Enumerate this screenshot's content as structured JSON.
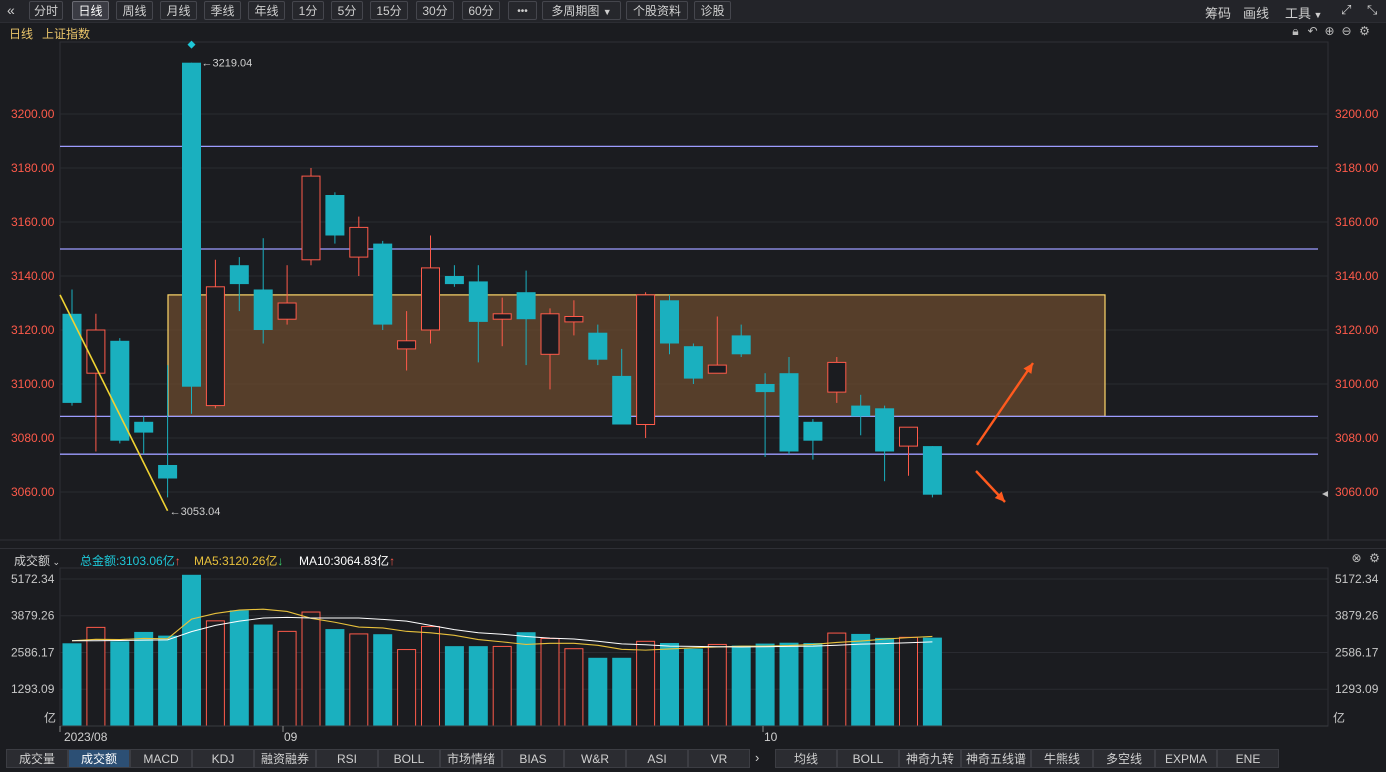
{
  "toolbar": {
    "back_icon": "double-chevron-left-icon",
    "periods": [
      "分时",
      "日线",
      "周线",
      "月线",
      "季线",
      "年线",
      "1分",
      "5分",
      "15分",
      "30分",
      "60分"
    ],
    "active_period": "日线",
    "more": "•••",
    "buttons": [
      "多周期图",
      "个股资料",
      "诊股"
    ],
    "right": {
      "chip": "筹码",
      "draw": "画线",
      "tools": "工具"
    }
  },
  "header": {
    "period": "日线",
    "index_name": "上证指数"
  },
  "price_axis": {
    "ticks": [
      "3200.00",
      "3180.00",
      "3160.00",
      "3140.00",
      "3120.00",
      "3100.00",
      "3080.00",
      "3060.00"
    ]
  },
  "annotations": {
    "high_label": "3219.04",
    "low_label": "3053.04"
  },
  "volume_header": {
    "dropdown": "成交额",
    "total_label": "总金额:3103.06亿",
    "ma5_label": "MA5:3120.26亿",
    "ma10_label": "MA10:3064.83亿"
  },
  "volume_axis": {
    "ticks": [
      "5172.34",
      "3879.26",
      "2586.17",
      "1293.09"
    ],
    "unit": "亿"
  },
  "date_labels": [
    "2023/08",
    "09",
    "10"
  ],
  "bottom_tabs": {
    "left": [
      "成交量",
      "成交额",
      "MACD",
      "KDJ",
      "融资融券",
      "RSI",
      "BOLL",
      "市场情绪",
      "BIAS",
      "W&R",
      "ASI",
      "VR"
    ],
    "active": "成交额",
    "right": [
      "均线",
      "BOLL",
      "神奇九转",
      "神奇五线谱",
      "牛熊线",
      "多空线",
      "EXPMA",
      "ENE"
    ]
  },
  "colors": {
    "up": "#ff5a4a",
    "down": "#1ab0bf",
    "ma5": "#e8c13c",
    "ma10": "#ffffff",
    "box_fill": "#6b4a2e",
    "box_border": "#ffd86a",
    "hline": "#9d9cff",
    "trend": "#f0d232",
    "arrow": "#ff5a1e"
  },
  "chart_data": {
    "type": "candlestick",
    "y_range": [
      3040,
      3230
    ],
    "candles": [
      {
        "o": 3126,
        "h": 3135,
        "l": 3092,
        "c": 3093
      },
      {
        "o": 3104,
        "h": 3126,
        "l": 3075,
        "c": 3120
      },
      {
        "o": 3116,
        "h": 3117,
        "l": 3078,
        "c": 3079
      },
      {
        "o": 3086,
        "h": 3088,
        "l": 3074,
        "c": 3082
      },
      {
        "o": 3070,
        "h": 3107,
        "l": 3058,
        "c": 3065
      },
      {
        "o": 3219,
        "h": 3219,
        "l": 3089,
        "c": 3099
      },
      {
        "o": 3092,
        "h": 3146,
        "l": 3091,
        "c": 3136
      },
      {
        "o": 3144,
        "h": 3147,
        "l": 3127,
        "c": 3137
      },
      {
        "o": 3135,
        "h": 3154,
        "l": 3115,
        "c": 3120
      },
      {
        "o": 3124,
        "h": 3144,
        "l": 3122,
        "c": 3130
      },
      {
        "o": 3146,
        "h": 3180,
        "l": 3144,
        "c": 3177
      },
      {
        "o": 3170,
        "h": 3171,
        "l": 3152,
        "c": 3155
      },
      {
        "o": 3147,
        "h": 3162,
        "l": 3140,
        "c": 3158
      },
      {
        "o": 3152,
        "h": 3153,
        "l": 3120,
        "c": 3122
      },
      {
        "o": 3113,
        "h": 3127,
        "l": 3105,
        "c": 3116
      },
      {
        "o": 3120,
        "h": 3155,
        "l": 3115,
        "c": 3143
      },
      {
        "o": 3140,
        "h": 3144,
        "l": 3136,
        "c": 3137
      },
      {
        "o": 3138,
        "h": 3144,
        "l": 3108,
        "c": 3123
      },
      {
        "o": 3124,
        "h": 3132,
        "l": 3114,
        "c": 3126
      },
      {
        "o": 3134,
        "h": 3142,
        "l": 3107,
        "c": 3124
      },
      {
        "o": 3111,
        "h": 3128,
        "l": 3098,
        "c": 3126
      },
      {
        "o": 3123,
        "h": 3131,
        "l": 3118,
        "c": 3125
      },
      {
        "o": 3119,
        "h": 3122,
        "l": 3107,
        "c": 3109
      },
      {
        "o": 3103,
        "h": 3113,
        "l": 3085,
        "c": 3085
      },
      {
        "o": 3085,
        "h": 3134,
        "l": 3080,
        "c": 3133
      },
      {
        "o": 3131,
        "h": 3133,
        "l": 3111,
        "c": 3115
      },
      {
        "o": 3114,
        "h": 3115,
        "l": 3100,
        "c": 3102
      },
      {
        "o": 3104,
        "h": 3125,
        "l": 3104,
        "c": 3107
      },
      {
        "o": 3118,
        "h": 3122,
        "l": 3110,
        "c": 3111
      },
      {
        "o": 3100,
        "h": 3104,
        "l": 3073,
        "c": 3097
      },
      {
        "o": 3104,
        "h": 3110,
        "l": 3074,
        "c": 3075
      },
      {
        "o": 3086,
        "h": 3087,
        "l": 3072,
        "c": 3079
      },
      {
        "o": 3097,
        "h": 3110,
        "l": 3093,
        "c": 3108
      },
      {
        "o": 3092,
        "h": 3096,
        "l": 3081,
        "c": 3088
      },
      {
        "o": 3091,
        "h": 3092,
        "l": 3064,
        "c": 3075
      },
      {
        "o": 3077,
        "h": 3084,
        "l": 3066,
        "c": 3084
      },
      {
        "o": 3077,
        "h": 3077,
        "l": 3058,
        "c": 3059
      }
    ],
    "volume": {
      "y_range": [
        0,
        5172.34
      ],
      "values": [
        2910,
        3470,
        2980,
        3310,
        3180,
        5320,
        3700,
        4070,
        3570,
        3330,
        4010,
        3410,
        3240,
        3230,
        2690,
        3500,
        2810,
        2810,
        2800,
        3300,
        3080,
        2720,
        2400,
        2400,
        2980,
        2920,
        2720,
        2870,
        2830,
        2900,
        2930,
        2920,
        3270,
        3240,
        3100,
        3120,
        3110
      ],
      "ma5": [
        3000,
        3050,
        3040,
        3080,
        3070,
        3760,
        3960,
        4080,
        4110,
        4030,
        3790,
        3650,
        3480,
        3450,
        3330,
        3280,
        3190,
        3040,
        2960,
        2870,
        2910,
        2910,
        2840,
        2700,
        2670,
        2710,
        2750,
        2780,
        2810,
        2810,
        2830,
        2870,
        2940,
        2990,
        3060,
        3110,
        3150
      ],
      "ma10": [
        3000,
        3000,
        3010,
        3020,
        3030,
        3320,
        3540,
        3690,
        3800,
        3820,
        3800,
        3800,
        3800,
        3750,
        3690,
        3540,
        3390,
        3280,
        3230,
        3150,
        3090,
        3060,
        2980,
        2890,
        2860,
        2810,
        2800,
        2790,
        2780,
        2790,
        2800,
        2810,
        2840,
        2880,
        2900,
        2930,
        2960
      ]
    }
  }
}
